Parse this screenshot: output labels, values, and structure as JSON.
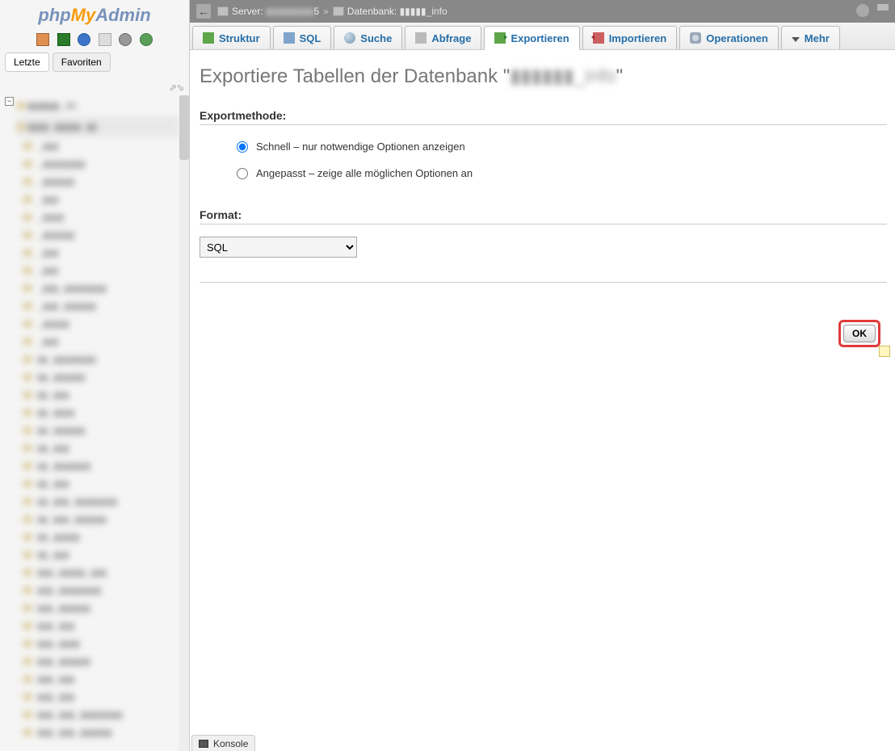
{
  "logo": {
    "php": "php",
    "my": "My",
    "admin": "Admin"
  },
  "nav_top": {
    "recent": "Letzte",
    "favorites": "Favoriten"
  },
  "breadcrumb": {
    "server_label": "Server:",
    "server_val": "▮▮▮▮▮▮▮▮▮",
    "server_suffix": "5",
    "db_label": "Datenbank:",
    "db_val": "▮▮▮▮▮_info"
  },
  "tabs": {
    "struktur": "Struktur",
    "sql": "SQL",
    "suche": "Suche",
    "abfrage": "Abfrage",
    "exportieren": "Exportieren",
    "importieren": "Importieren",
    "operationen": "Operationen",
    "mehr": "Mehr"
  },
  "page": {
    "title_prefix": "Exportiere Tabellen der Datenbank \"",
    "title_db": "▮▮▮▮▮▮_info",
    "title_suffix": "\"",
    "export_method": "Exportmethode:",
    "quick": "Schnell – nur notwendige Optionen anzeigen",
    "custom": "Angepasst – zeige alle möglichen Optionen an",
    "format": "Format:",
    "format_value": "SQL",
    "ok": "OK"
  },
  "console": "Konsole",
  "tree_db": "▮▮▮▮▮▮_db",
  "tree_items": [
    "_▮▮▮",
    "_▮▮▮▮▮▮▮▮",
    "_▮▮▮▮▮▮",
    "_▮▮▮",
    "_▮▮▮▮",
    "_▮▮▮▮▮▮",
    "_▮▮▮",
    "_▮▮▮",
    "_▮▮▮_▮▮▮▮▮▮▮▮",
    "_▮▮▮_▮▮▮▮▮▮",
    "_▮▮▮▮▮",
    "_▮▮▮",
    "▮▮_▮▮▮▮▮▮▮▮",
    "▮▮_▮▮▮▮▮▮",
    "▮▮_▮▮▮",
    "▮▮_▮▮▮▮",
    "▮▮_▮▮▮▮▮▮",
    "▮▮_▮▮▮",
    "▮▮_▮▮▮▮▮▮▮",
    "▮▮_▮▮▮",
    "▮▮_▮▮▮_▮▮▮▮▮▮▮▮",
    "▮▮_▮▮▮_▮▮▮▮▮▮",
    "▮▮_▮▮▮▮▮",
    "▮▮_▮▮▮",
    "▮▮▮_▮▮▮▮▮_▮▮▮",
    "▮▮▮_▮▮▮▮▮▮▮▮",
    "▮▮▮_▮▮▮▮▮▮",
    "▮▮▮_▮▮▮",
    "▮▮▮_▮▮▮▮",
    "▮▮▮_▮▮▮▮▮▮",
    "▮▮▮_▮▮▮",
    "▮▮▮_▮▮▮",
    "▮▮▮_▮▮▮_▮▮▮▮▮▮▮▮",
    "▮▮▮_▮▮▮_▮▮▮▮▮▮"
  ]
}
